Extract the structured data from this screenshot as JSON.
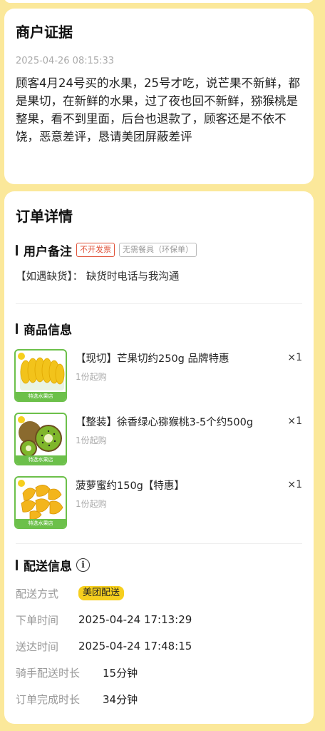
{
  "evidence": {
    "title": "商户证据",
    "timestamp": "2025-04-26 08:15:33",
    "text": "顾客4月24号买的水果，25号才吃，说芒果不新鲜，都是果切，在新鲜的水果，过了夜也回不新鲜，猕猴桃是整果，看不到里面，后台也退款了，顾客还是不依不饶，恶意差评，恳请美团屏蔽差评"
  },
  "order": {
    "title": "订单详情",
    "remark": {
      "section_title": "用户备注",
      "tags": [
        "不开发票",
        "无需餐具（环保单）"
      ],
      "text": "【如遇缺货】： 缺货时电话与我沟通"
    },
    "goods": {
      "section_title": "商品信息",
      "items": [
        {
          "name": "【现切】芒果切约250g 品牌特惠",
          "min": "1份起购",
          "qty": "×1",
          "thumb_label": "特选水果店",
          "icon": "mango-icon"
        },
        {
          "name": "【整装】徐香绿心猕猴桃3-5个约500g",
          "min": "1份起购",
          "qty": "×1",
          "thumb_label": "特选水果店",
          "icon": "kiwi-icon"
        },
        {
          "name": "菠萝蜜约150g【特惠】",
          "min": "1份起购",
          "qty": "×1",
          "thumb_label": "特选水果店",
          "icon": "jackfruit-icon"
        }
      ]
    },
    "delivery": {
      "section_title": "配送信息",
      "info_icon": "ⓘ",
      "rows": [
        {
          "label": "配送方式",
          "value": "美团配送"
        },
        {
          "label": "下单时间",
          "value": "2025-04-24 17:13:29"
        },
        {
          "label": "送达时间",
          "value": "2025-04-24 17:48:15"
        },
        {
          "label": "骑手配送时长",
          "value": "15分钟"
        },
        {
          "label": "订单完成时长",
          "value": "34分钟"
        }
      ]
    }
  },
  "colors": {
    "page_bg": "#fbe89a",
    "tag_red": "#e0533a",
    "thumb_green": "#6cc04a",
    "delivery_badge": "#f6cf1e"
  }
}
